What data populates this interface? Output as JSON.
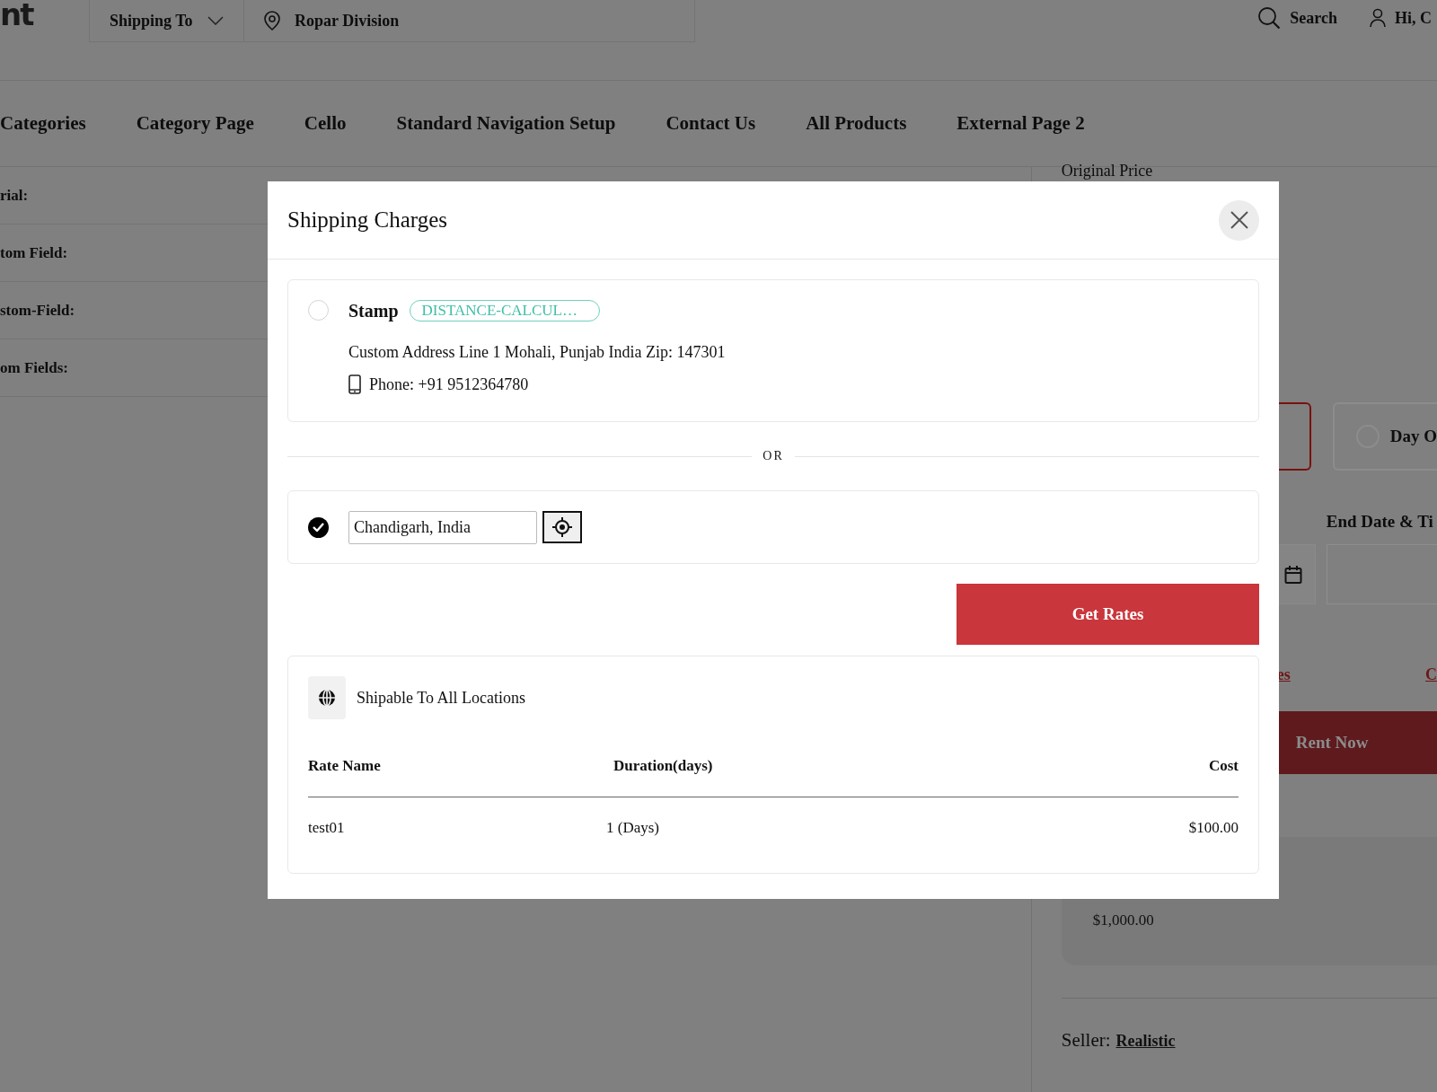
{
  "header": {
    "logo": "nt",
    "shipping_to": "Shipping To",
    "location": "Ropar Division",
    "search": "Search",
    "user": "Hi, C"
  },
  "nav": [
    "Categories",
    "Category Page",
    "Cello",
    "Standard Navigation Setup",
    "Contact Us",
    "All Products",
    "External Page 2"
  ],
  "attributes": [
    "rial:",
    "tom Field:",
    "stom-Field:",
    "om Fields:"
  ],
  "product": {
    "original_price": "Original Price",
    "options": [
      {
        "selected": true
      },
      {
        "label": "Day O",
        "selected": false
      }
    ],
    "end_date_label": "End Date & Ti",
    "links": [
      "es",
      "C"
    ],
    "rent_button": "Rent Now",
    "price": "$1,000.00",
    "seller_label": "Seller:",
    "seller": "Realistic"
  },
  "modal": {
    "title": "Shipping Charges",
    "options": [
      {
        "kind": "address",
        "selected": false,
        "name": "Stamp",
        "badge": "DISTANCE-CALCUL…",
        "address": "Custom Address Line 1 Mohali, Punjab India Zip: 147301",
        "phone": "Phone: +91 9512364780"
      },
      {
        "kind": "location",
        "selected": true,
        "value": "Chandigarh, India"
      }
    ],
    "separator": "OR",
    "button": "Get Rates",
    "results": {
      "heading": "Shipable To All Locations",
      "columns": [
        "Rate Name",
        "Duration(days)",
        "Cost"
      ],
      "rows": [
        [
          "test01",
          "1 (Days)",
          "$100.00"
        ]
      ]
    }
  }
}
